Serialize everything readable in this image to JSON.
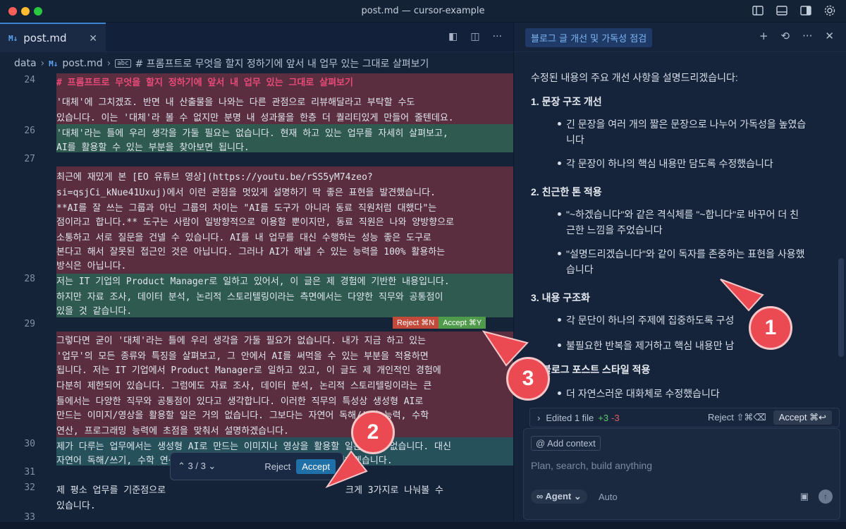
{
  "window": {
    "title": "post.md — cursor-example"
  },
  "editor": {
    "tab": {
      "icon": "M↓",
      "name": "post.md"
    },
    "breadcrumb": [
      "data",
      "post.md",
      "# 프롬프트로 무엇을 할지 정하기에 앞서 내 업무 있는 그대로 살펴보기"
    ],
    "line_numbers": [
      "24",
      "26",
      "27",
      "28",
      "29",
      "30",
      "31",
      "32",
      "33"
    ],
    "lines": [
      "# 프롬프트로 무엇을 할지 정하기에 앞서 내 업무 있는 그대로 살펴보기",
      "'대체'에 그치겠죠. 반면 내 산출물을 나와는 다른 관점으로 리뷰해달라고 부탁할 수도",
      "있습니다. 이는 '대체'라 볼 수 없지만 분명 내 성과물을 한층 더 퀄리티있게 만들어 줄텐데요.",
      "'대체'라는 틀에 우리 생각을 가둘 필요는 없습니다. 현재 하고 있는 업무를 자세히 살펴보고,",
      "AI를 활용할 수 있는 부분을 찾아보면 됩니다.",
      "최근에 재밌게 본 [EO 유튜브 영상](https://youtu.be/rSS5yM74zeo?",
      "si=qsjCi_kNue41Uxuj)에서 이런 관점을 멋있게 설명하기 딱 좋은 표현을 발견했습니다.",
      "**AI를 잘 쓰는 그룹과 아닌 그룹의 차이는 \"AI를 도구가 아니라 동료 직원처럼 대했다\"는",
      "점이라고 합니다.** 도구는 사람이 일방향적으로 이용할 뿐이지만, 동료 직원은 나와 양방향으로",
      "소통하고 서로 질문을 건넬 수 있습니다. AI를 내 업무를 대신 수행하는 성능 좋은 도구로",
      "본다고 해서 잘못된 접근인 것은 아닙니다. 그러나 AI가 해낼 수 있는 능력을 100% 활용하는",
      "방식은 아닙니다.",
      "저는 IT 기업의 Product Manager로 일하고 있어서, 이 글은 제 경험에 기반한 내용입니다.",
      "하지만 자료 조사, 데이터 분석, 논리적 스토리텔링이라는 측면에서는 다양한 직무와 공통점이",
      "있을 것 같습니다.",
      "그렇다면 굳이 '대체'라는 틀에 우리 생각을 가둘 필요가 없습니다. 내가 지금 하고 있는",
      "'업무'의 모든 종류와 특징을 살펴보고, 그 안에서 AI를 써먹을 수 있는 부분을 적용하면",
      "됩니다. 저는 IT 기업에서 Product Manager로 일하고 있고, 이 글도 제 개인적인 경험에",
      "다분히 제한되어 있습니다. 그럼에도 자료 조사, 데이터 분석, 논리적 스토리텔링이라는 큰",
      "틀에서는 다양한 직무와 공통점이 있다고 생각합니다. 이러한 직무의 특성상 생성형 AI로",
      "만드는 이미지/영상을 활용할 일은 거의 없습니다. 그보다는 자연어 독해/쓰기 능력, 수학",
      "연산, 프로그래밍 능력에 초점을 맞춰서 설명하겠습니다.",
      "제가 다루는 업무에서는 생성형 AI로 만드는 이미지나 영상을 활용할 일은 거의 없습니다. 대신",
      "자연어 독해/쓰기, 수학 연산, 프로그래밍 능력에 초점을 맞춰서 설명하겠습니다.",
      "제 평소 업무를 기준점으로",
      "크게 3가지로 나눠볼 수",
      "있습니다."
    ],
    "inline_reject": "Reject ⌘N",
    "inline_accept": "Accept ⌘Y",
    "diffbar": {
      "nav": "⌃ 3 / 3 ⌄",
      "reject": "Reject",
      "accept": "Accept"
    }
  },
  "chat": {
    "tab_title": "블로그 글 개선 및 가독성 점검",
    "intro": "수정된 내용의 주요 개선 사항을 설명드리겠습니다:",
    "sections": [
      {
        "title": "1. 문장 구조 개선",
        "bullets": [
          [
            "긴 문장을 여러 개의 짧은 문장으로 나누어 가독성을 높였습",
            "니다"
          ],
          [
            "각 문장이 하나의 핵심 내용만 담도록 수정했습니다"
          ]
        ]
      },
      {
        "title": "2. 친근한 톤 적용",
        "bullets": [
          [
            "\"~하겠습니다\"와 같은 격식체를 \"~합니다\"로 바꾸어 더 친",
            "근한 느낌을 주었습니다"
          ],
          [
            "\"설명드리겠습니다\"와 같이 독자를 존중하는 표현을 사용했",
            "습니다"
          ]
        ]
      },
      {
        "title": "3. 내용 구조화",
        "bullets": [
          [
            "각 문단이 하나의 주제에 집중하도록 구성"
          ],
          [
            "불필요한 반복을 제거하고 핵심 내용만 남"
          ]
        ]
      },
      {
        "title": "블로그 포스트 스타일 적용",
        "bullets": [
          [
            "더 자연스러운 대화체로 수정했습니다"
          ]
        ]
      }
    ],
    "edited": {
      "label": "Edited 1 file",
      "plus": "+3",
      "minus": "-3",
      "reject": "Reject ⇧⌘⌫",
      "accept": "Accept ⌘↩"
    },
    "compose": {
      "add_context": "Add context",
      "placeholder": "Plan, search, build anything",
      "mode": "Agent",
      "model": "Auto"
    }
  },
  "annotations": {
    "one": "1",
    "two": "2",
    "three": "3"
  },
  "colors": {
    "accent": "#3d86d6",
    "callout": "#eb4a52",
    "deleted_bg": "#5a2e3e",
    "added_bg": "#2f5a50"
  }
}
